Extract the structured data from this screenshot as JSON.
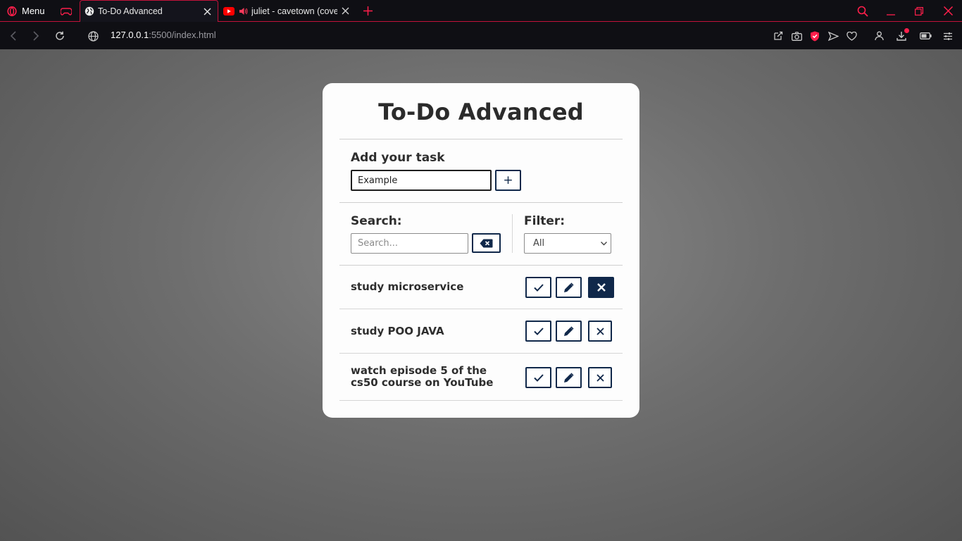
{
  "browser": {
    "menu_label": "Menu",
    "tabs": [
      {
        "title": "To-Do Advanced",
        "icon": "globe-icon",
        "active": true
      },
      {
        "title": "juliet - cavetown (cover)",
        "icon": "youtube-icon",
        "audio": true,
        "active": false
      }
    ],
    "url_host": "127.0.0.1",
    "url_path": ":5500/index.html",
    "accent_color": "#ff1f4b"
  },
  "app": {
    "title": "To-Do Advanced",
    "add_label": "Add your task",
    "task_input_value": "Example",
    "add_button_label": "+",
    "search_label": "Search:",
    "search_placeholder": "Search...",
    "filter_label": "Filter:",
    "filter_selected": "All",
    "primary_color": "#10284a",
    "tasks": [
      {
        "text": "study microservice"
      },
      {
        "text": "study POO JAVA"
      },
      {
        "text": "watch episode 5 of the cs50 course on YouTube"
      }
    ]
  }
}
